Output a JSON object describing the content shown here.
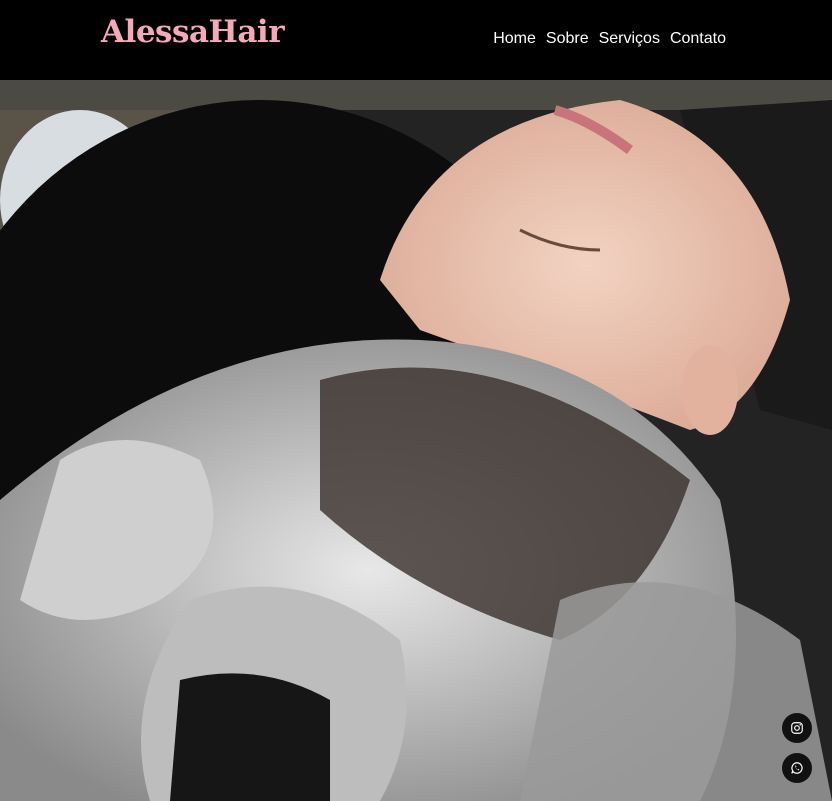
{
  "brand": {
    "name": "AlessaHair",
    "color": "#f4a9b8"
  },
  "nav": {
    "items": [
      {
        "label": "Home"
      },
      {
        "label": "Sobre"
      },
      {
        "label": "Serviços"
      },
      {
        "label": "Contato"
      }
    ]
  },
  "hero": {
    "image": "salon-hair-wash-photo"
  },
  "social": {
    "icons": [
      "instagram-icon",
      "whatsapp-icon"
    ]
  }
}
